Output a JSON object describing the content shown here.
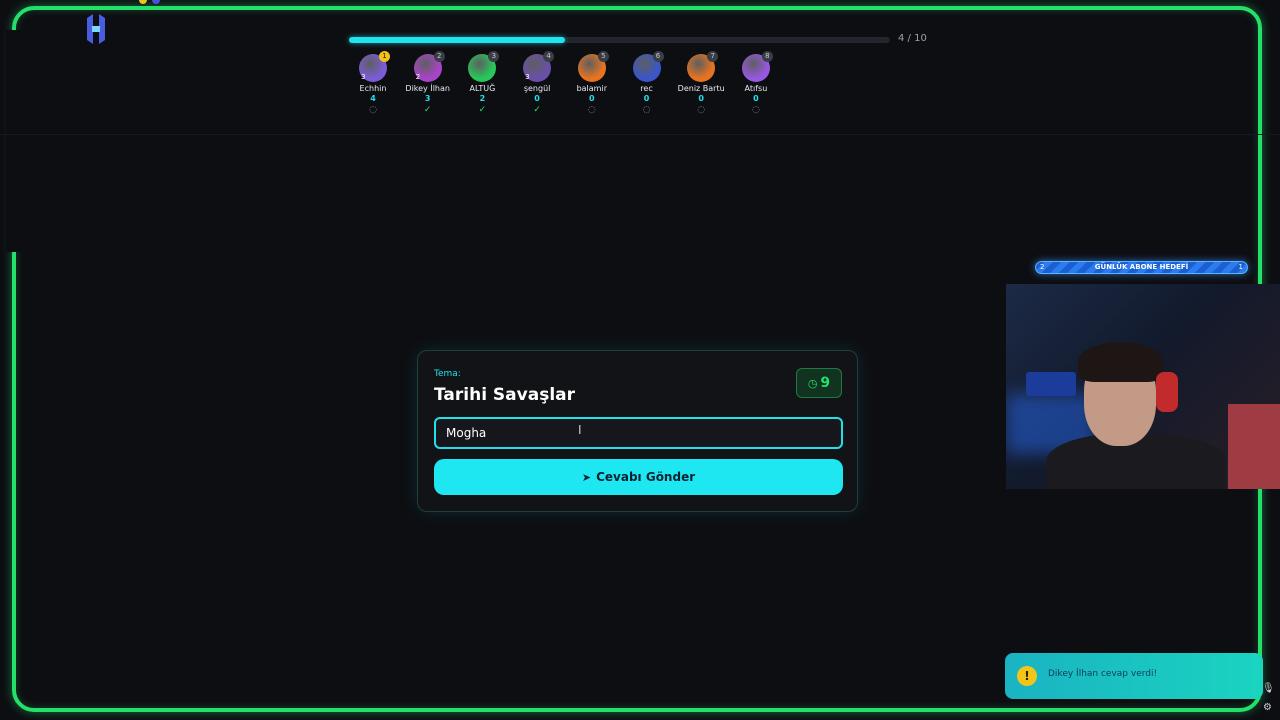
{
  "progress": {
    "current": 4,
    "total": 10,
    "label": "4 / 10",
    "fraction": 0.4
  },
  "players": [
    {
      "name": "Echhin",
      "score": "4",
      "rank": "1",
      "streak": "3",
      "status": "waiting",
      "color": "#7b5cd6"
    },
    {
      "name": "Dikey İlhan",
      "score": "3",
      "rank": "2",
      "streak": "2",
      "status": "answered",
      "color": "#a944c9"
    },
    {
      "name": "ALTUĞ",
      "score": "2",
      "rank": "3",
      "streak": "",
      "status": "answered",
      "color": "#27c85a"
    },
    {
      "name": "şengül",
      "score": "0",
      "rank": "4",
      "streak": "3",
      "status": "answered",
      "color": "#6a4fa8"
    },
    {
      "name": "balamir",
      "score": "0",
      "rank": "5",
      "streak": "",
      "status": "waiting",
      "color": "#e8731e"
    },
    {
      "name": "rec",
      "score": "0",
      "rank": "6",
      "streak": "",
      "status": "waiting",
      "color": "#3a56c9"
    },
    {
      "name": "Deniz Bartu",
      "score": "0",
      "rank": "7",
      "streak": "",
      "status": "waiting",
      "color": "#e8731e"
    },
    {
      "name": "Atıfsu",
      "score": "0",
      "rank": "8",
      "streak": "",
      "status": "waiting",
      "color": "#9658e0"
    }
  ],
  "status_icons": {
    "answered": "✓",
    "waiting": "◌"
  },
  "question": {
    "theme_label": "Tema:",
    "theme": "Tarihi Savaşlar",
    "timer": "9",
    "answer_value": "Mogha",
    "send_label": "Cevabı Gönder"
  },
  "goal": {
    "left": "2",
    "label": "GÜNLÜK ABONE HEDEFİ",
    "right": "1"
  },
  "toast": {
    "text": "Dikey İlhan cevap verdi!"
  },
  "colors": {
    "accent": "#20e3f0",
    "frame": "#22e06a",
    "success": "#22e06a",
    "background": "#0d0e12"
  }
}
